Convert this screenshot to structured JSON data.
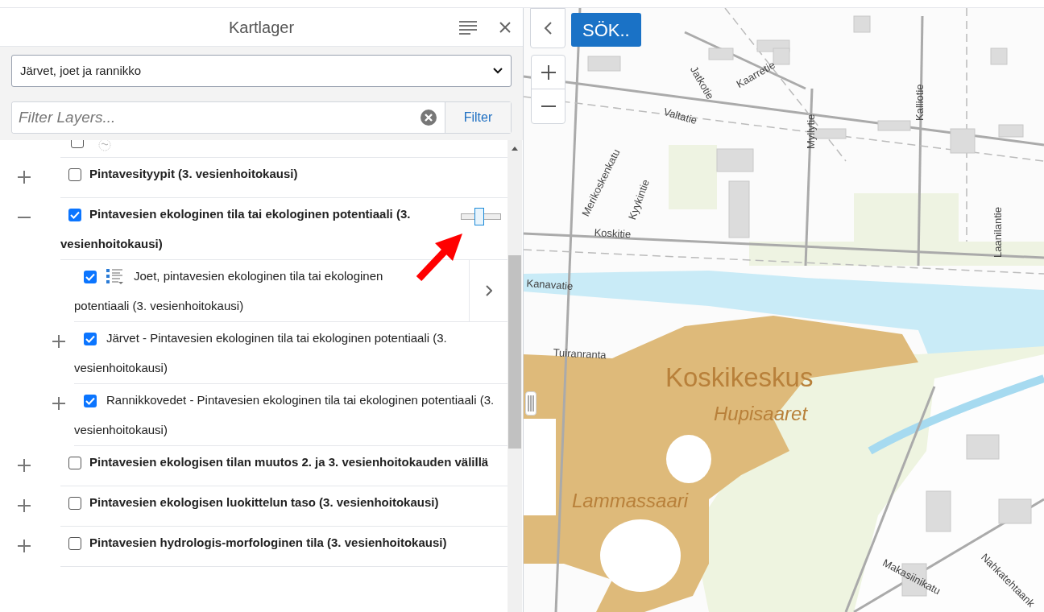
{
  "panel": {
    "title": "Kartlager",
    "theme_select": "Järvet, joet ja rannikko",
    "filter": {
      "placeholder": "Filter Layers...",
      "button": "Filter"
    }
  },
  "layers": [
    {
      "kind": "partial",
      "checked": false
    },
    {
      "kind": "group",
      "label": "Pintavesityypit (3. vesienhoitokausi)",
      "checked": false,
      "expanded": false
    },
    {
      "kind": "group",
      "label": "Pintavesien ekologinen tila tai ekologinen potentiaali (3. vesienhoitokausi)",
      "checked": true,
      "expanded": true,
      "level": 0.45,
      "children": [
        {
          "kind": "layer",
          "label": "Joet, pintavesien ekologinen tila tai ekologinen potentiaali (3. vesienhoitokausi)",
          "checked": true
        },
        {
          "kind": "group",
          "label": "Järvet - Pintavesien ekologinen tila tai ekologinen potentiaali (3. vesienhoitokausi)",
          "checked": true,
          "expanded": false
        },
        {
          "kind": "group",
          "label": "Rannikkovedet - Pintavesien ekologinen tila tai ekologinen potentiaali (3. vesienhoitokausi)",
          "checked": true,
          "expanded": false
        }
      ]
    },
    {
      "kind": "group",
      "label": "Pintavesien ekologisen tilan muutos 2. ja 3. vesienhoitokauden välillä",
      "checked": false,
      "expanded": false
    },
    {
      "kind": "group",
      "label": "Pintavesien ekologisen luokittelun taso (3. vesienhoitokausi)",
      "checked": false,
      "expanded": false
    },
    {
      "kind": "group",
      "label": "Pintavesien hydrologis-morfologinen tila (3. vesienhoitokausi)",
      "checked": false,
      "expanded": false
    }
  ],
  "map": {
    "search_button": "SÖK..",
    "labels": [
      {
        "text": "Koskikeskus",
        "kind": "major"
      },
      {
        "text": "Hupisaaret",
        "kind": "area"
      },
      {
        "text": "Lammassaari",
        "kind": "area"
      },
      {
        "text": "Kanavatie",
        "kind": "street"
      },
      {
        "text": "Tuiranranta",
        "kind": "street"
      },
      {
        "text": "Koskitie",
        "kind": "street"
      },
      {
        "text": "Valtatie",
        "kind": "street"
      },
      {
        "text": "Kaarretie",
        "kind": "street"
      },
      {
        "text": "Jatkotie",
        "kind": "street"
      },
      {
        "text": "Merikoskenkatu",
        "kind": "street"
      },
      {
        "text": "Myllytie",
        "kind": "street"
      },
      {
        "text": "Kalliotie",
        "kind": "street"
      },
      {
        "text": "Laanilantie",
        "kind": "street"
      },
      {
        "text": "Kyykintie",
        "kind": "street"
      },
      {
        "text": "Makasiinikatu",
        "kind": "street"
      },
      {
        "text": "Nahkatehtaank",
        "kind": "street"
      }
    ]
  }
}
